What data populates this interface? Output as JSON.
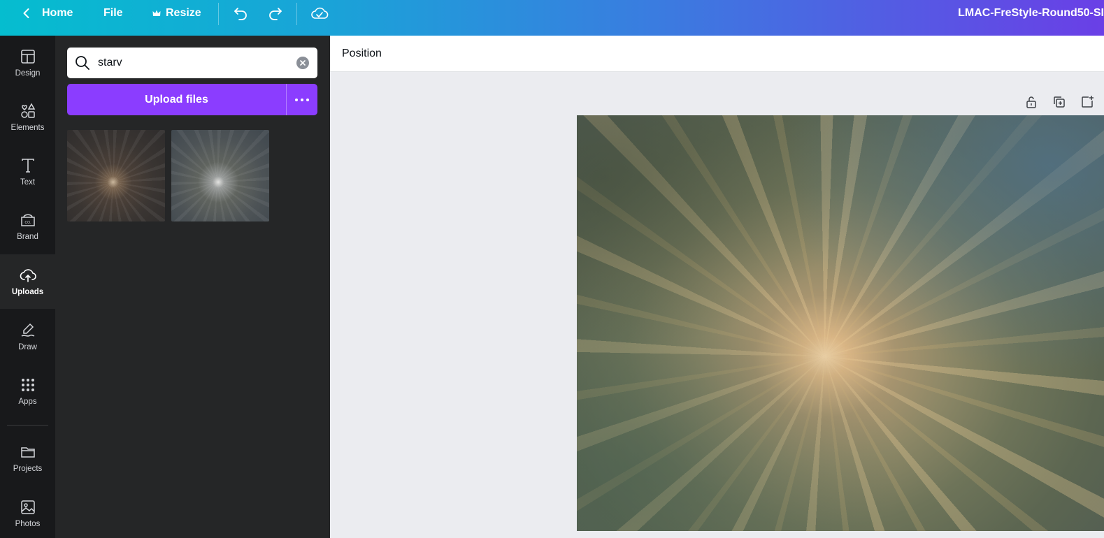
{
  "topbar": {
    "home_label": "Home",
    "file_label": "File",
    "resize_label": "Resize",
    "design_title": "LMAC-FreStyle-Round50-SI"
  },
  "rail": {
    "items": [
      {
        "label": "Design",
        "icon": "design-icon"
      },
      {
        "label": "Elements",
        "icon": "elements-icon"
      },
      {
        "label": "Text",
        "icon": "text-icon"
      },
      {
        "label": "Brand",
        "icon": "brand-icon"
      },
      {
        "label": "Uploads",
        "icon": "upload-cloud-icon",
        "active": true
      },
      {
        "label": "Draw",
        "icon": "draw-icon"
      },
      {
        "label": "Apps",
        "icon": "apps-icon"
      },
      {
        "label": "Projects",
        "icon": "folder-icon"
      },
      {
        "label": "Photos",
        "icon": "photos-icon"
      }
    ]
  },
  "panel": {
    "search_value": "starv",
    "upload_label": "Upload files"
  },
  "editor": {
    "position_label": "Position"
  },
  "colors": {
    "accent": "#8b3dff",
    "rail_bg": "#18191b",
    "panel_bg": "#252627",
    "canvas_bg": "#ebecf0"
  }
}
